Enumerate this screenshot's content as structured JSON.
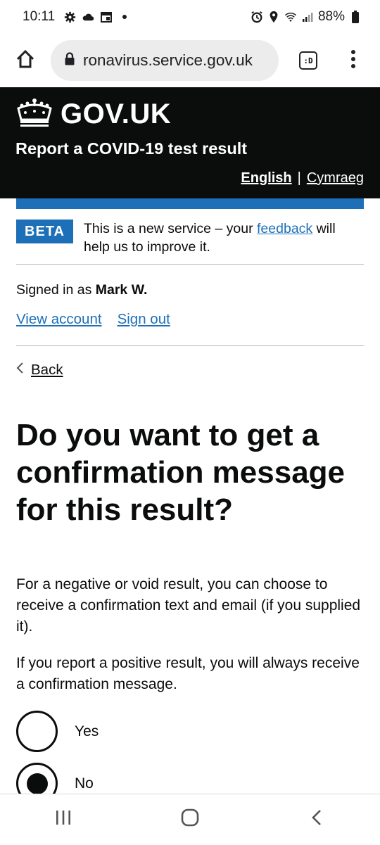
{
  "status_bar": {
    "time": "10:11",
    "battery": "88%",
    "left_icons": [
      "settings-gear-icon",
      "cloud-icon",
      "calendar-icon",
      "notification-dot-icon"
    ],
    "right_icons": [
      "alarm-icon",
      "location-pin-icon",
      "wifi-icon",
      "signal-icon",
      "battery-icon"
    ]
  },
  "browser": {
    "url": "ronavirus.service.gov.uk",
    "tab_icon_text": ":D",
    "icons": [
      "home-icon",
      "lock-icon",
      "tab-switcher-icon",
      "overflow-menu-icon"
    ]
  },
  "header": {
    "logo_text": "GOV.UK",
    "service_name": "Report a COVID-19 test result",
    "languages": [
      "English",
      "Cymraeg"
    ],
    "language_separator": "|",
    "colors": {
      "background": "#0b0c0c",
      "accent_bar": "#1d70b8"
    }
  },
  "phase_banner": {
    "tag": "BETA",
    "text_before": "This is a new service – your ",
    "link": "feedback",
    "text_after": " will help us to improve it."
  },
  "account": {
    "signed_in_prefix": "Signed in as ",
    "user_name": "Mark W.",
    "view_account": "View account",
    "sign_out": "Sign out"
  },
  "back": {
    "label": "Back"
  },
  "main": {
    "heading": "Do you want to get a confirmation message for this result?",
    "paragraph_1": "For a negative or void result, you can choose to receive a confirmation text and email (if you supplied it).",
    "paragraph_2": "If you report a positive result, you will always receive a confirmation message.",
    "options": [
      {
        "label": "Yes",
        "selected": false
      },
      {
        "label": "No",
        "selected": true
      }
    ]
  },
  "nav_bar": {
    "icons": [
      "recent-apps-icon",
      "home-circle-icon",
      "back-chevron-icon"
    ]
  },
  "colors": {
    "link": "#1d70b8",
    "text": "#0b0c0c",
    "rule": "#b1b4b6"
  }
}
